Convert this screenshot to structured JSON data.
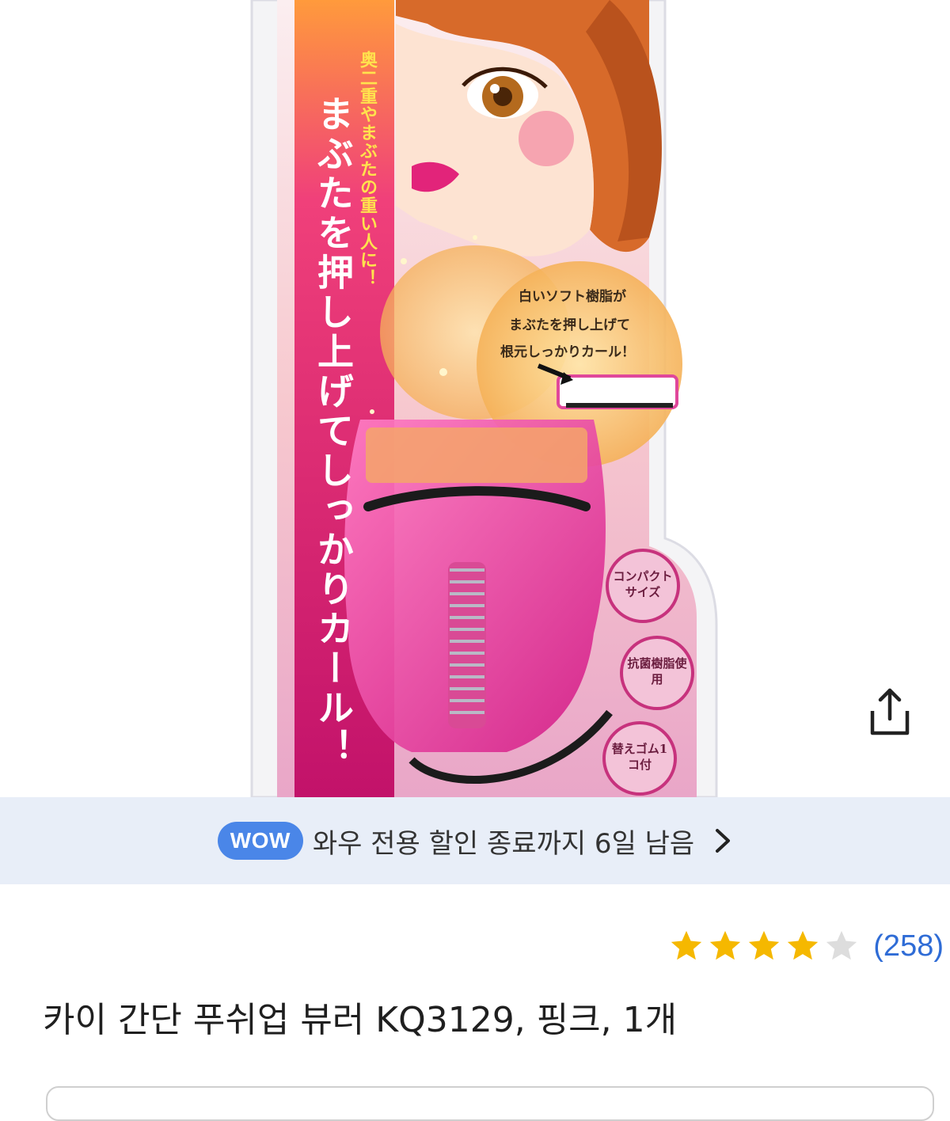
{
  "product_image": {
    "package_text": {
      "main_vertical": "まぶたを押し上げてしっかりカール！",
      "sub_vertical": "奥二重やまぶたの重い人に！",
      "callout_lines": [
        "白いソフト樹脂が",
        "まぶたを押し上げて",
        "根元しっかりカール！"
      ],
      "badges": [
        "コンパクトサイズ",
        "抗菌樹脂使用",
        "替えゴム1コ付"
      ]
    }
  },
  "share": {
    "icon": "share-icon"
  },
  "wow_banner": {
    "badge": "WOW",
    "text": "와우 전용 할인 종료까지 6일 남음",
    "chevron_icon": "chevron-right-icon",
    "badge_color": "#4a86e8",
    "background": "#e8eef8"
  },
  "rating": {
    "stars": 4,
    "max_stars": 5,
    "review_count": "(258)",
    "star_color": "#f5b800"
  },
  "product": {
    "title": "카이 간단 푸쉬업 뷰러 KQ3129, 핑크, 1개"
  }
}
